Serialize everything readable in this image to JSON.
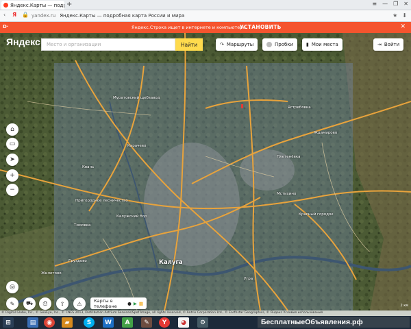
{
  "browser": {
    "tab_title": "Яндекс.Карты — подро",
    "tab_close": "×",
    "new_tab": "+",
    "window_controls": [
      "≡",
      "—",
      "❐",
      "✕"
    ],
    "address_host": "yandex.ru",
    "address_title": "Яндекс.Карты — подробная карта России и мира",
    "address_right": [
      "★",
      "⬇"
    ]
  },
  "promo": {
    "left": "D·",
    "message": "Яндекс.Строка ищет в интернете и компьютере",
    "install": "УСТАНОВИТЬ",
    "close": "✕"
  },
  "header": {
    "logo": "Яндекс",
    "search_placeholder": "Место и организации",
    "find_button": "Найти",
    "routes": "Маршруты",
    "traffic": "Пробки",
    "my_places": "Мои места",
    "login": "Войти"
  },
  "map_labels": {
    "city": "Калуга",
    "places": [
      "Муратовский щебзавод",
      "Карачево",
      "Ястребовка",
      "Квань",
      "Плетенёвка",
      "Калужский бор",
      "Пригородное лесничество",
      "Тимовка",
      "Красный городок",
      "Ждамирово",
      "Угра",
      "Жилетово",
      "Мстихино",
      "Груздово"
    ]
  },
  "bottom": {
    "phone_button": "Карты в телефоне",
    "copyright": "© Digital Globe, Inc., © GeoEye, Inc., © CNES 2013, Distribution Astrium Services/Spot Image, all rights reserved, © Antrix Corporation Ltd., © Earthstar Geographics, © Яндекс Условия использования",
    "scale": "2 км"
  },
  "watermark": "БесплатныеОбъявления.рф",
  "colors": {
    "promo": "#f5542e",
    "find_button": "#ffdb4d",
    "road": "#e8a33c"
  }
}
